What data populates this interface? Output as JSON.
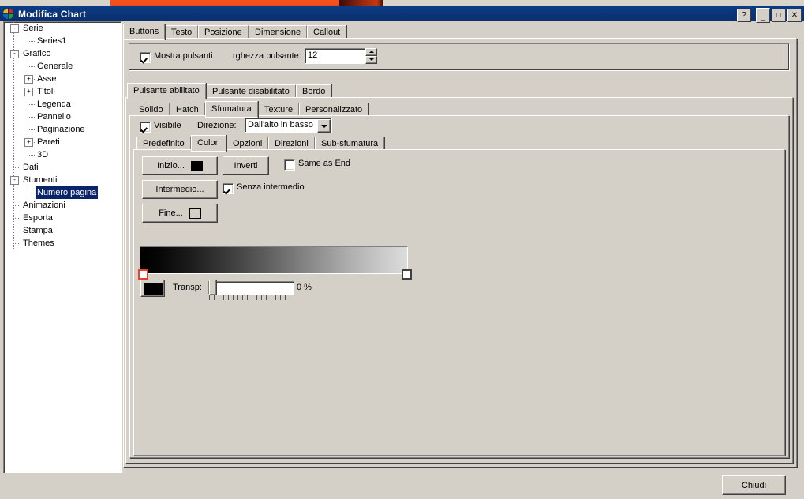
{
  "window": {
    "title": "Modifica Chart",
    "icon": "chart-pie-icon",
    "caption_buttons": [
      {
        "name": "help-button",
        "glyph": "?"
      },
      {
        "name": "minimize-button",
        "glyph": "_"
      },
      {
        "name": "maximize-button",
        "glyph": "□"
      },
      {
        "name": "close-button",
        "glyph": "✕"
      }
    ]
  },
  "tree": {
    "nodes": [
      {
        "label": "Serie",
        "level": 0,
        "expander": "-",
        "selected": false
      },
      {
        "label": "Series1",
        "level": 1,
        "expander": "",
        "selected": false
      },
      {
        "label": "Grafico",
        "level": 0,
        "expander": "-",
        "selected": false
      },
      {
        "label": "Generale",
        "level": 1,
        "expander": "",
        "selected": false
      },
      {
        "label": "Asse",
        "level": 1,
        "expander": "+",
        "selected": false
      },
      {
        "label": "Titoli",
        "level": 1,
        "expander": "+",
        "selected": false
      },
      {
        "label": "Legenda",
        "level": 1,
        "expander": "",
        "selected": false
      },
      {
        "label": "Pannello",
        "level": 1,
        "expander": "",
        "selected": false
      },
      {
        "label": "Paginazione",
        "level": 1,
        "expander": "",
        "selected": false
      },
      {
        "label": "Pareti",
        "level": 1,
        "expander": "+",
        "selected": false
      },
      {
        "label": "3D",
        "level": 1,
        "expander": "",
        "selected": false
      },
      {
        "label": "Dati",
        "level": 0,
        "expander": "",
        "selected": false
      },
      {
        "label": "Stumenti",
        "level": 0,
        "expander": "-",
        "selected": false
      },
      {
        "label": "Numero pagina",
        "level": 1,
        "expander": "",
        "selected": true
      },
      {
        "label": "Animazioni",
        "level": 0,
        "expander": "",
        "selected": false
      },
      {
        "label": "Esporta",
        "level": 0,
        "expander": "",
        "selected": false
      },
      {
        "label": "Stampa",
        "level": 0,
        "expander": "",
        "selected": false
      },
      {
        "label": "Themes",
        "level": 0,
        "expander": "",
        "selected": false
      }
    ]
  },
  "tabs_level1": [
    {
      "label": "Buttons",
      "active": true
    },
    {
      "label": "Testo",
      "active": false
    },
    {
      "label": "Posizione",
      "active": false
    },
    {
      "label": "Dimensione",
      "active": false
    },
    {
      "label": "Callout",
      "active": false
    }
  ],
  "buttons_panel": {
    "show_buttons_checkbox": {
      "label": "Mostra pulsanti",
      "checked": true
    },
    "width_label": "rghezza pulsante:",
    "width_value": "12"
  },
  "tabs_level2": [
    {
      "label": "Pulsante abilitato",
      "active": true
    },
    {
      "label": "Pulsante disabilitato",
      "active": false
    },
    {
      "label": "Bordo",
      "active": false
    }
  ],
  "tabs_level3": [
    {
      "label": "Solido",
      "active": false
    },
    {
      "label": "Hatch",
      "active": false
    },
    {
      "label": "Sfumatura",
      "active": true
    },
    {
      "label": "Texture",
      "active": false
    },
    {
      "label": "Personalizzato",
      "active": false
    }
  ],
  "gradient_panel": {
    "visible_checkbox": {
      "label": "Visibile",
      "checked": true
    },
    "direction_label": "Direzione:",
    "direction_value": "Dall'alto in basso"
  },
  "tabs_level4": [
    {
      "label": "Predefinito",
      "active": false
    },
    {
      "label": "Colori",
      "active": true
    },
    {
      "label": "Opzioni",
      "active": false
    },
    {
      "label": "Direzioni",
      "active": false
    },
    {
      "label": "Sub-sfumatura",
      "active": false
    }
  ],
  "colors_tab": {
    "start_button": "Inizio...",
    "start_color": "#000000",
    "invert_button": "Inverti",
    "same_as_end_checkbox": {
      "label": "Same as End",
      "checked": false
    },
    "middle_button": "Intermedio...",
    "no_middle_checkbox": {
      "label": "Senza intermedio",
      "checked": true
    },
    "end_button": "Fine...",
    "end_color": "#d4d0c8",
    "gradient_start": "#000000",
    "gradient_end": "#dcdcdc",
    "preview_swatch_color": "#000000",
    "transparency_label": "Transp:",
    "transparency_value": "0 %"
  },
  "footer": {
    "close_button": "Chiudi"
  }
}
